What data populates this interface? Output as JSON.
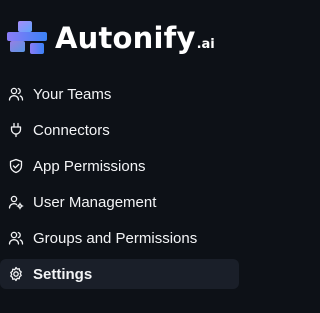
{
  "brand": {
    "name": "Autonify",
    "suffix": ".ai",
    "colors": {
      "gradient_start": "#9b8cff",
      "gradient_end": "#4ea8ff"
    }
  },
  "sidebar": {
    "active_index": 5,
    "items": [
      {
        "label": "Your Teams",
        "icon": "users-icon"
      },
      {
        "label": "Connectors",
        "icon": "plug-icon"
      },
      {
        "label": "App Permissions",
        "icon": "shield-check-icon"
      },
      {
        "label": "User Management",
        "icon": "user-cog-icon"
      },
      {
        "label": "Groups and Permissions",
        "icon": "users-icon"
      },
      {
        "label": "Settings",
        "icon": "gear-icon"
      }
    ]
  },
  "colors": {
    "background": "#0d1117",
    "active_item_background": "#1a1f29",
    "text": "#f3f4f6"
  }
}
